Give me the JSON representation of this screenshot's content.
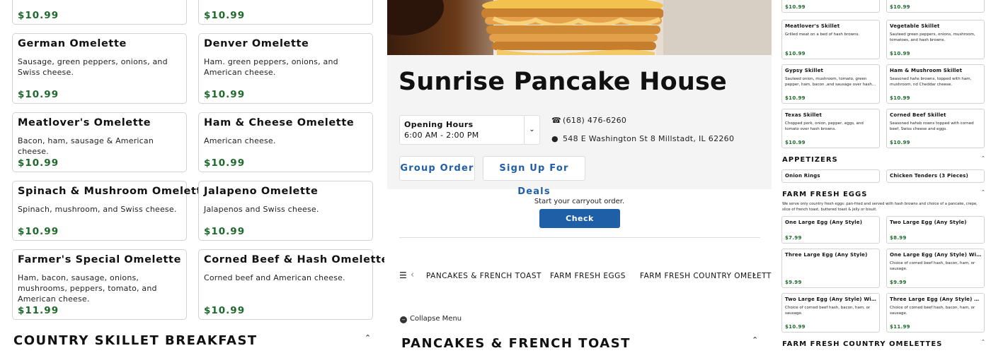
{
  "omelettes": [
    {
      "name": "",
      "desc": "",
      "price": "$10.99"
    },
    {
      "name": "",
      "desc": "",
      "price": "$10.99"
    },
    {
      "name": "German Omelette",
      "desc": "Sausage, green peppers, onions, and Swiss cheese.",
      "price": "$10.99"
    },
    {
      "name": "Denver Omelette",
      "desc": "Ham. green peppers, onions, and American cheese.",
      "price": "$10.99"
    },
    {
      "name": "Meatlover's Omelette",
      "desc": "Bacon, ham, sausage & American cheese.",
      "price": "$10.99"
    },
    {
      "name": "Ham & Cheese Omelette",
      "desc": "American cheese.",
      "price": "$10.99"
    },
    {
      "name": "Spinach & Mushroom Omelette",
      "desc": "Spinach, mushroom, and Swiss cheese.",
      "price": "$10.99"
    },
    {
      "name": "Jalapeno Omelette",
      "desc": "Jalapenos and Swiss cheese.",
      "price": "$10.99"
    },
    {
      "name": "Farmer's Special Omelette",
      "desc": "Ham, bacon, sausage, onions, mushrooms, peppers, tomato, and American cheese.",
      "price": "$11.99"
    },
    {
      "name": "Corned Beef & Hash Omelette",
      "desc": "Corned beef and American cheese.",
      "price": "$10.99"
    }
  ],
  "left_section_title": "COUNTRY SKILLET BREAKFAST",
  "restaurant": {
    "name": "Sunrise Pancake House",
    "hours_label": "Opening Hours",
    "hours_value": "6:00 AM - 2:00 PM",
    "phone": "(618) 476-6260",
    "address": "548 E Washington St 8 Millstadt, IL 62260",
    "group_order": "Group Order",
    "signup": "Sign Up For Deals",
    "carryout": "Start your carryout order.",
    "check": "Check Availability"
  },
  "category_tabs": [
    "PANCAKES & FRENCH TOAST",
    "FARM FRESH EGGS",
    "FARM FRESH COUNTRY OMELETTES"
  ],
  "collapse_menu": "Collapse Menu",
  "center_section_title": "PANCAKES & FRENCH TOAST",
  "skillets": [
    {
      "name": "",
      "desc": "",
      "price": "$10.99"
    },
    {
      "name": "",
      "desc": "",
      "price": "$10.99"
    },
    {
      "name": "Meatlover's Skillet",
      "desc": "Grilled meat on a bed of hash browns.",
      "price": "$10.99"
    },
    {
      "name": "Vegetable Skillet",
      "desc": "Sauteed green peppers, onions, mushroom, tomatoes, and hash browns.",
      "price": "$10.99"
    },
    {
      "name": "Gypsy Skillet",
      "desc": "Sauteed onion, mushroom, tomato, green pepper, ham, bacon ,and sausage over hash...",
      "price": "$10.99"
    },
    {
      "name": "Ham & Mushroom Skillet",
      "desc": "Seasoned hahs browns, topped with ham, mushroom, nd Cheddar cheese.",
      "price": "$10.99"
    },
    {
      "name": "Texas Skillet",
      "desc": "Chopped pork, onion, pepper, eggs, and tomato over hash browns.",
      "price": "$10.99"
    },
    {
      "name": "Corned Beef Skillet",
      "desc": "Seasoned hahsb rowns topped with corned beef, Swiss cheese and eggs.",
      "price": "$10.99"
    }
  ],
  "appetizers": {
    "title": "APPETIZERS",
    "items": [
      "Onion Rings",
      "Chicken Tenders (3 Pieces)"
    ]
  },
  "eggs": {
    "title": "FARM FRESH EGGS",
    "note": "We serve only country fresh eggs: pan-fried and served with hash browns and choice of a pancake, crepe, slice of french toast, buttered toast & jelly or bisuit.",
    "items": [
      {
        "name": "One Large Egg (Any Style)",
        "desc": "",
        "price": "$7.99"
      },
      {
        "name": "Two Large Egg (Any Style)",
        "desc": "",
        "price": "$8.99"
      },
      {
        "name": "Three Large Egg (Any Style)",
        "desc": "",
        "price": "$9.99"
      },
      {
        "name": "One Large Egg (Any Style) With...",
        "desc": "Choice of corned beef hash, bacon, ham, or sausage.",
        "price": "$9.99"
      },
      {
        "name": "Two Large Egg (Any Style) With...",
        "desc": "Choice of corned beef hash, bacon, ham, or sausage.",
        "price": "$10.99"
      },
      {
        "name": "Three Large Egg (Any Style) With...",
        "desc": "Choice of corned beef hash, bacon, ham, or sausage.",
        "price": "$11.99"
      }
    ]
  },
  "right_omelettes_title": "FARM FRESH COUNTRY OMELETTES"
}
